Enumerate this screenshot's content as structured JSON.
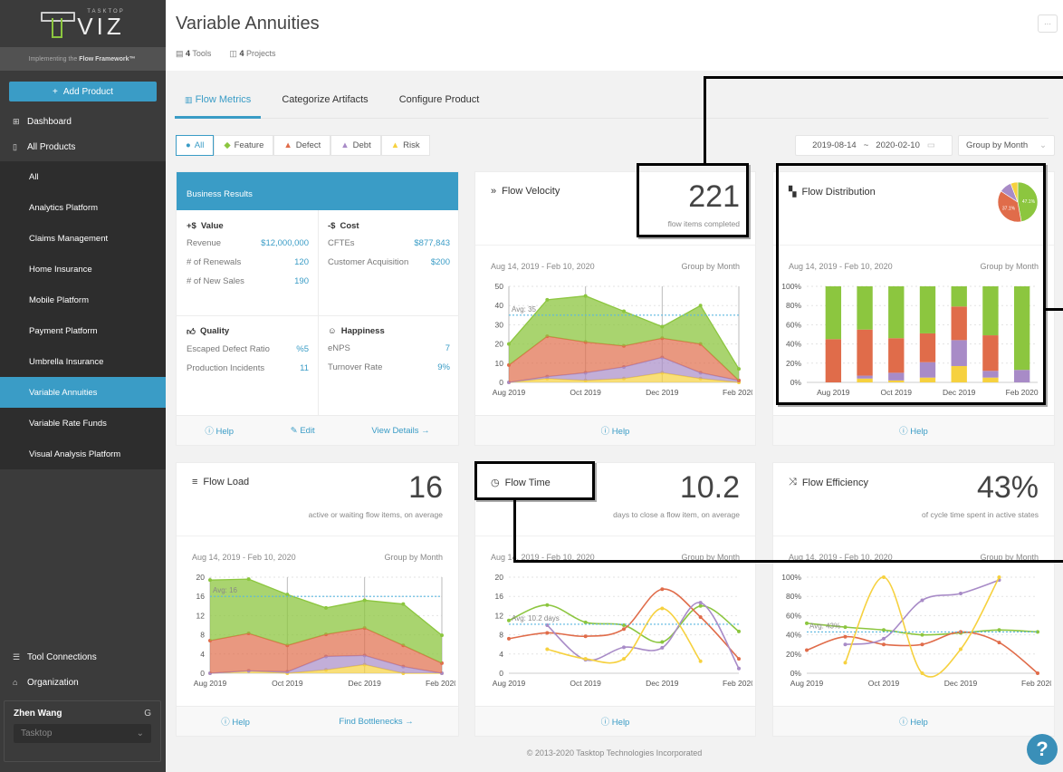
{
  "sidebar": {
    "logo_small": "TASKTOP",
    "logo_big": "VIZ",
    "tagline_pre": "Implementing the",
    "tagline_bold": "Flow Framework™",
    "add_product": "Add Product",
    "nav": [
      {
        "label": "Dashboard",
        "icon": "dashboard-icon"
      },
      {
        "label": "All Products",
        "icon": "products-icon"
      }
    ],
    "products": [
      "All",
      "Analytics Platform",
      "Claims Management",
      "Home Insurance",
      "Mobile Platform",
      "Payment Platform",
      "Umbrella Insurance",
      "Variable Annuities",
      "Variable Rate Funds",
      "Visual Analysis Platform"
    ],
    "active_product": "Variable Annuities",
    "bottom_nav": [
      {
        "label": "Tool Connections",
        "icon": "tool-connections-icon"
      },
      {
        "label": "Organization",
        "icon": "organization-icon"
      }
    ],
    "user_name": "Zhen Wang",
    "organization": "Tasktop"
  },
  "header": {
    "title": "Variable Annuities",
    "tools_count": "4",
    "tools_label": "Tools",
    "projects_count": "4",
    "projects_label": "Projects",
    "more_label": "···"
  },
  "tabs": [
    "Flow Metrics",
    "Categorize Artifacts",
    "Configure Product"
  ],
  "active_tab": "Flow Metrics",
  "filters": [
    "All",
    "Feature",
    "Defect",
    "Debt",
    "Risk"
  ],
  "active_filter": "All",
  "date_from": "2019-08-14",
  "date_sep": "~",
  "date_to": "2020-02-10",
  "group_by": "Group by Month",
  "colors": {
    "feature": "#8cc63f",
    "defect": "#e06c4a",
    "debt": "#a88bc7",
    "risk": "#f6d13f",
    "accent": "#3a9cc6",
    "avg": "#5bb7e0"
  },
  "business": {
    "title": "Business Results",
    "value": {
      "title": "Value",
      "icon": "+$",
      "rows": [
        [
          "Revenue",
          "$12,000,000"
        ],
        [
          "# of Renewals",
          "120"
        ],
        [
          "# of New Sales",
          "190"
        ]
      ]
    },
    "cost": {
      "title": "Cost",
      "icon": "-$",
      "rows": [
        [
          "CFTEs",
          "$877,843"
        ],
        [
          "Customer Acquisition",
          "$200"
        ]
      ]
    },
    "quality": {
      "title": "Quality",
      "rows": [
        [
          "Escaped Defect Ratio",
          "%5"
        ],
        [
          "Production Incidents",
          "11"
        ]
      ]
    },
    "happiness": {
      "title": "Happiness",
      "rows": [
        [
          "eNPS",
          "7"
        ],
        [
          "Turnover Rate",
          "9%"
        ]
      ]
    },
    "footer": [
      "Help",
      "Edit",
      "View Details →"
    ]
  },
  "range_label": "Aug 14, 2019 - Feb 10, 2020",
  "help_label": "Help",
  "find_bottlenecks": "Find Bottlenecks →",
  "footer_text": "© 2013-2020 Tasktop Technologies Incorporated",
  "help_fab": "?",
  "chart_data": [
    {
      "id": "velocity",
      "title": "Flow Velocity",
      "metric": "221",
      "metric_label": "flow items completed",
      "type": "area",
      "stacked": true,
      "avg_label": "Avg: 35",
      "avg": 35,
      "ylim": [
        0,
        50
      ],
      "yticks": [
        0,
        10,
        20,
        30,
        40,
        50
      ],
      "xticks": [
        "Aug 2019",
        "Oct 2019",
        "Dec 2019",
        "Feb 2020"
      ],
      "x_count": 7,
      "series": [
        {
          "name": "Risk",
          "values": [
            0,
            2,
            1,
            2,
            5,
            2,
            0
          ]
        },
        {
          "name": "Debt",
          "values": [
            0,
            1,
            4,
            6,
            8,
            3,
            1
          ]
        },
        {
          "name": "Defect",
          "values": [
            9,
            21,
            16,
            11,
            10,
            15,
            0
          ]
        },
        {
          "name": "Feature",
          "values": [
            11,
            19,
            24,
            18,
            6,
            20,
            6
          ]
        }
      ]
    },
    {
      "id": "distribution",
      "title": "Flow Distribution",
      "type": "bar",
      "stacked": true,
      "ylim": [
        0,
        100
      ],
      "yticks": [
        "0%",
        "20%",
        "40%",
        "60%",
        "80%",
        "100%"
      ],
      "xticks": [
        "Aug 2019",
        "Oct 2019",
        "Dec 2019",
        "Feb 2020"
      ],
      "x_count": 7,
      "series": [
        {
          "name": "Risk",
          "values": [
            0,
            4,
            2,
            5,
            17,
            5,
            0
          ]
        },
        {
          "name": "Debt",
          "values": [
            0,
            3,
            8,
            16,
            27,
            7,
            13
          ]
        },
        {
          "name": "Defect",
          "values": [
            45,
            48,
            36,
            30,
            35,
            37,
            0
          ]
        },
        {
          "name": "Feature",
          "values": [
            55,
            45,
            54,
            49,
            21,
            51,
            87
          ]
        }
      ],
      "pie": {
        "labels": [
          "Feature",
          "Defect",
          "Debt",
          "Risk"
        ],
        "values": [
          47.1,
          37.1,
          10,
          5.8
        ],
        "shown_labels": [
          "47.1%",
          "37.1%"
        ]
      }
    },
    {
      "id": "load",
      "title": "Flow Load",
      "metric": "16",
      "metric_label": "active or waiting flow items, on average",
      "type": "area",
      "stacked": true,
      "avg_label": "Avg: 16",
      "avg": 16,
      "ylim": [
        0,
        20
      ],
      "yticks": [
        0,
        4,
        8,
        12,
        16,
        20
      ],
      "xticks": [
        "Aug 2019",
        "Oct 2019",
        "Dec 2019",
        "Feb 2020"
      ],
      "x_count": 7,
      "series": [
        {
          "name": "Risk",
          "values": [
            0,
            0.5,
            0,
            0.7,
            1.8,
            0,
            0
          ]
        },
        {
          "name": "Debt",
          "values": [
            0,
            0,
            0.3,
            2.8,
            1.9,
            1.4,
            0
          ]
        },
        {
          "name": "Defect",
          "values": [
            6.8,
            7.8,
            5.5,
            4.6,
            5.7,
            4.4,
            2.1
          ]
        },
        {
          "name": "Feature",
          "values": [
            12.6,
            11.3,
            10.6,
            5.5,
            5.8,
            8.6,
            5.8
          ]
        }
      ]
    },
    {
      "id": "time",
      "title": "Flow Time",
      "metric": "10.2",
      "metric_label": "days to close a flow item, on average",
      "type": "line",
      "avg_label": "Avg: 10.2 days",
      "avg": 10.2,
      "ylim": [
        0,
        20
      ],
      "yticks": [
        0,
        4,
        8,
        12,
        16,
        20
      ],
      "xticks": [
        "Aug 2019",
        "Oct 2019",
        "Dec 2019",
        "Feb 2020"
      ],
      "x_count": 7,
      "series": [
        {
          "name": "Feature",
          "values": [
            11,
            14.2,
            10.6,
            10,
            6.5,
            14,
            8.7
          ]
        },
        {
          "name": "Defect",
          "values": [
            7.2,
            8.4,
            7.7,
            9.2,
            17.5,
            11.7,
            3
          ]
        },
        {
          "name": "Debt",
          "values": [
            null,
            10,
            2.8,
            5.4,
            5.3,
            14.7,
            1
          ]
        },
        {
          "name": "Risk",
          "values": [
            null,
            5,
            3,
            3,
            13.5,
            2.5,
            null
          ]
        }
      ]
    },
    {
      "id": "efficiency",
      "title": "Flow Efficiency",
      "metric": "43%",
      "metric_label": "of cycle time spent in active states",
      "type": "line",
      "avg_label": "Avg: 43%",
      "avg": 43,
      "ylim": [
        0,
        100
      ],
      "yticks": [
        "0%",
        "20%",
        "40%",
        "60%",
        "80%",
        "100%"
      ],
      "xticks": [
        "Aug 2019",
        "Oct 2019",
        "Dec 2019",
        "Feb 2020"
      ],
      "x_count": 7,
      "series": [
        {
          "name": "Feature",
          "values": [
            52,
            48,
            45,
            40,
            42,
            45,
            43
          ]
        },
        {
          "name": "Defect",
          "values": [
            24,
            38,
            30,
            30,
            43,
            32,
            0
          ]
        },
        {
          "name": "Debt",
          "values": [
            null,
            30,
            36,
            76,
            83,
            97,
            null
          ]
        },
        {
          "name": "Risk",
          "values": [
            null,
            11,
            100,
            0,
            25,
            100,
            null
          ]
        }
      ]
    }
  ]
}
